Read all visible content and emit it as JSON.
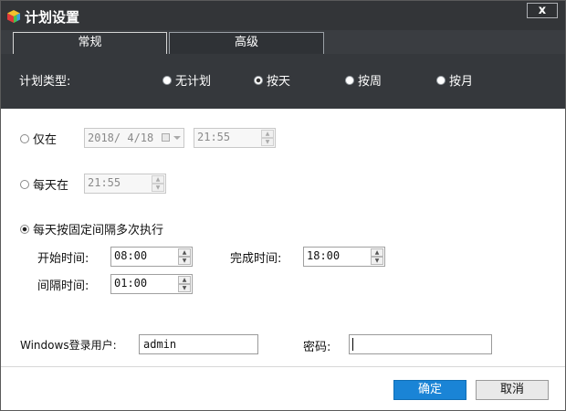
{
  "window": {
    "title": "计划设置",
    "close_label": "x"
  },
  "tabs": [
    {
      "label": "常规"
    },
    {
      "label": "高级"
    }
  ],
  "schedule_type": {
    "label": "计划类型:",
    "options": [
      {
        "label": "无计划"
      },
      {
        "label": "按天"
      },
      {
        "label": "按周"
      },
      {
        "label": "按月"
      }
    ],
    "selected": "按天"
  },
  "modes": {
    "only_at": {
      "label": "仅在",
      "date": "2018/ 4/18",
      "time": "21:55"
    },
    "daily_at": {
      "label": "每天在",
      "time": "21:55"
    },
    "interval": {
      "label": "每天按固定间隔多次执行",
      "start_label": "开始时间:",
      "start_time": "08:00",
      "end_label": "完成时间:",
      "end_time": "18:00",
      "interval_label": "间隔时间:",
      "interval_time": "01:00"
    },
    "selected": "interval"
  },
  "credentials": {
    "user_label": "Windows登录用户:",
    "user_value": "admin",
    "password_label": "密码:",
    "password_value": ""
  },
  "buttons": {
    "ok": "确定",
    "cancel": "取消"
  },
  "colors": {
    "title_bar": "#333538",
    "dark_panel": "#35383c",
    "primary_button": "#1a84d6"
  },
  "icons": {
    "app": "colorful-cube-icon",
    "close": "close-icon"
  }
}
